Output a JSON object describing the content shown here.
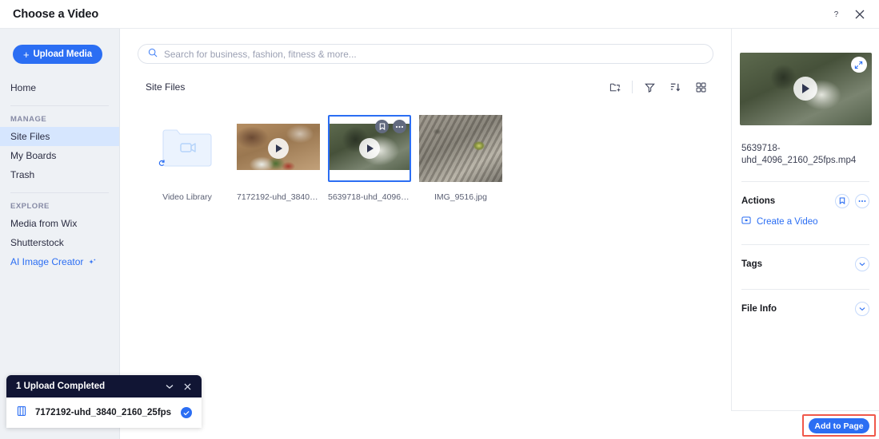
{
  "header": {
    "title": "Choose a Video",
    "help_icon": "question-mark-icon",
    "close_icon": "close-icon"
  },
  "sidebar": {
    "upload_button": "Upload Media",
    "home": "Home",
    "groups": [
      {
        "title": "MANAGE",
        "items": [
          {
            "label": "Site Files",
            "active": true
          },
          {
            "label": "My Boards",
            "active": false
          },
          {
            "label": "Trash",
            "active": false
          }
        ]
      },
      {
        "title": "EXPLORE",
        "items": [
          {
            "label": "Media from Wix",
            "active": false
          },
          {
            "label": "Shutterstock",
            "active": false
          },
          {
            "label": "AI Image Creator",
            "active": false,
            "blue": true,
            "sparkle": true
          }
        ]
      }
    ]
  },
  "search": {
    "placeholder": "Search for business, fashion, fitness & more...",
    "value": "",
    "icon": "search-icon"
  },
  "main": {
    "section_title": "Site Files",
    "toolbar": [
      {
        "name": "new-folder-icon",
        "title": "New Folder"
      },
      {
        "name": "filter-icon",
        "title": "Filter"
      },
      {
        "name": "sort-icon",
        "title": "Sort"
      },
      {
        "name": "grid-view-icon",
        "title": "View"
      }
    ],
    "items": [
      {
        "label": "Video Library",
        "kind": "folder",
        "selected": false
      },
      {
        "label": "7172192-uhd_3840_2160...",
        "kind": "video",
        "selected": false
      },
      {
        "label": "5639718-uhd_4096_2160...",
        "kind": "video",
        "selected": true
      },
      {
        "label": "IMG_9516.jpg",
        "kind": "image",
        "selected": false
      }
    ]
  },
  "right_panel": {
    "file_name": "5639718-uhd_4096_2160_25fps.mp4",
    "expand_icon": "expand-icon",
    "play_icon": "play-icon",
    "actions_title": "Actions",
    "bookmark_icon": "bookmark-icon",
    "more_icon": "more-options-icon",
    "create_video_label": "Create a Video",
    "create_video_icon": "video-create-icon",
    "tags_title": "Tags",
    "file_info_title": "File Info",
    "chevron_icon": "chevron-down-icon"
  },
  "footer": {
    "add_to_page": "Add to Page",
    "highlight_color": "#f0584a"
  },
  "toast": {
    "title": "1 Upload Completed",
    "collapse_icon": "chevron-down-icon",
    "close_icon": "close-icon",
    "file_name": "7172192-uhd_3840_2160_25fps",
    "file_icon": "film-strip-icon",
    "status_icon": "check-circle-icon"
  },
  "colors": {
    "accent": "#2b6ef3",
    "sidebar_bg": "#eef1f5",
    "active_nav": "#d6e6fe",
    "toast_header": "#111534"
  }
}
